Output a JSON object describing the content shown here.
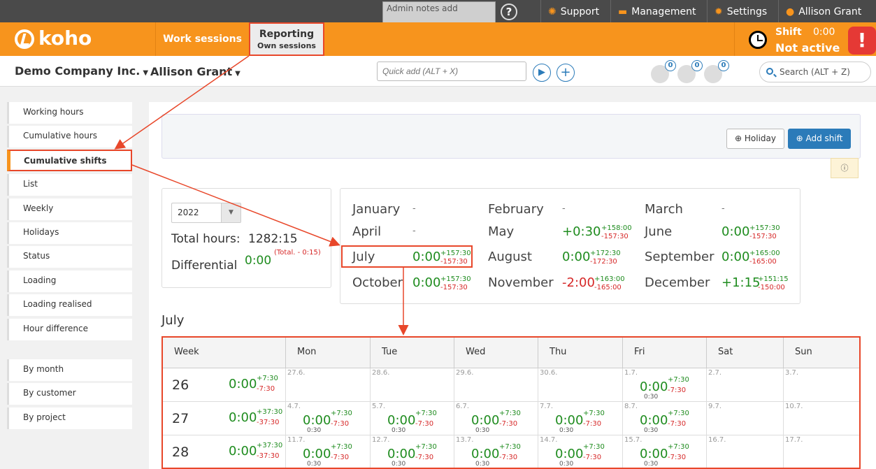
{
  "topbar": {
    "admin_notes_placeholder": "Admin notes add",
    "help": "?",
    "links": [
      {
        "label": "Support",
        "icon": "lifebuoy-icon"
      },
      {
        "label": "Management",
        "icon": "management-icon"
      },
      {
        "label": "Settings",
        "icon": "gear-icon"
      },
      {
        "label": "Allison Grant",
        "icon": "user-icon"
      }
    ]
  },
  "header": {
    "logo": "koho",
    "tabs": [
      {
        "label": "Work sessions",
        "sub": ""
      },
      {
        "label": "Reporting",
        "sub": "Own sessions"
      }
    ],
    "shift": {
      "label": "Shift",
      "time": "0:00",
      "status": "Not active"
    },
    "alert": "!"
  },
  "subheader": {
    "company": "Demo Company Inc.",
    "person": "Allison Grant",
    "quick_add_placeholder": "Quick add (ALT + X)",
    "notifications": [
      "0",
      "0",
      "0"
    ],
    "search_placeholder": "Search (ALT + Z)"
  },
  "sidebar": {
    "items": [
      "Working hours",
      "Cumulative hours",
      "Cumulative shifts",
      "List",
      "Weekly",
      "Holidays",
      "Status",
      "Loading",
      "Loading realised",
      "Hour difference"
    ],
    "group2": [
      "By month",
      "By customer",
      "By project"
    ]
  },
  "toolbar": {
    "holiday": "Holiday",
    "add_shift": "Add shift",
    "info": "i"
  },
  "year_panel": {
    "year": "2022",
    "total_label": "Total hours:",
    "total_value": "1282:15",
    "diff_label": "Differential",
    "diff_value": "0:00",
    "diff_note": "(Total. - 0:15)"
  },
  "months": [
    {
      "name": "January",
      "value": "-",
      "plus": "",
      "minus": ""
    },
    {
      "name": "February",
      "value": "-",
      "plus": "",
      "minus": ""
    },
    {
      "name": "March",
      "value": "-",
      "plus": "",
      "minus": ""
    },
    {
      "name": "April",
      "value": "-",
      "plus": "",
      "minus": ""
    },
    {
      "name": "May",
      "value": "+0:30",
      "plus": "+158:00",
      "minus": "-157:30"
    },
    {
      "name": "June",
      "value": "0:00",
      "plus": "+157:30",
      "minus": "-157:30"
    },
    {
      "name": "July",
      "value": "0:00",
      "plus": "+157:30",
      "minus": "-157:30"
    },
    {
      "name": "August",
      "value": "0:00",
      "plus": "+172:30",
      "minus": "-172:30"
    },
    {
      "name": "September",
      "value": "0:00",
      "plus": "+165:00",
      "minus": "-165:00"
    },
    {
      "name": "October",
      "value": "0:00",
      "plus": "+157:30",
      "minus": "-157:30"
    },
    {
      "name": "November",
      "value": "-2:00",
      "plus": "+163:00",
      "minus": "-165:00"
    },
    {
      "name": "December",
      "value": "+1:15",
      "plus": "+151:15",
      "minus": "-150:00"
    }
  ],
  "month_title": "July",
  "calendar": {
    "headers": [
      "Week",
      "Mon",
      "Tue",
      "Wed",
      "Thu",
      "Fri",
      "Sat",
      "Sun"
    ],
    "rows": [
      {
        "week": "26",
        "val": "0:00",
        "plus": "+7:30",
        "minus": "-7:30",
        "days": [
          {
            "date": "27.6."
          },
          {
            "date": "28.6."
          },
          {
            "date": "29.6."
          },
          {
            "date": "30.6."
          },
          {
            "date": "1.7.",
            "val": "0:00",
            "sub": "0:30",
            "plus": "+7:30",
            "minus": "-7:30"
          },
          {
            "date": "2.7."
          },
          {
            "date": "3.7."
          }
        ]
      },
      {
        "week": "27",
        "val": "0:00",
        "plus": "+37:30",
        "minus": "-37:30",
        "days": [
          {
            "date": "4.7.",
            "val": "0:00",
            "sub": "0:30",
            "plus": "+7:30",
            "minus": "-7:30"
          },
          {
            "date": "5.7.",
            "val": "0:00",
            "sub": "0:30",
            "plus": "+7:30",
            "minus": "-7:30"
          },
          {
            "date": "6.7.",
            "val": "0:00",
            "sub": "0:30",
            "plus": "+7:30",
            "minus": "-7:30"
          },
          {
            "date": "7.7.",
            "val": "0:00",
            "sub": "0:30",
            "plus": "+7:30",
            "minus": "-7:30"
          },
          {
            "date": "8.7.",
            "val": "0:00",
            "sub": "0:30",
            "plus": "+7:30",
            "minus": "-7:30"
          },
          {
            "date": "9.7."
          },
          {
            "date": "10.7."
          }
        ]
      },
      {
        "week": "28",
        "val": "0:00",
        "plus": "+37:30",
        "minus": "-37:30",
        "days": [
          {
            "date": "11.7.",
            "val": "0:00",
            "sub": "0:30",
            "plus": "+7:30",
            "minus": "-7:30"
          },
          {
            "date": "12.7.",
            "val": "0:00",
            "sub": "0:30",
            "plus": "+7:30",
            "minus": "-7:30"
          },
          {
            "date": "13.7.",
            "val": "0:00",
            "sub": "0:30",
            "plus": "+7:30",
            "minus": "-7:30"
          },
          {
            "date": "14.7.",
            "val": "0:00",
            "sub": "0:30",
            "plus": "+7:30",
            "minus": "-7:30"
          },
          {
            "date": "15.7.",
            "val": "0:00",
            "sub": "0:30",
            "plus": "+7:30",
            "minus": "-7:30"
          },
          {
            "date": "16.7."
          },
          {
            "date": "17.7."
          }
        ]
      }
    ]
  },
  "colors": {
    "brand": "#f7941d",
    "accent": "#2b7bb9",
    "positive": "#1f8c1f",
    "negative": "#d62828",
    "highlight": "#e8472a"
  }
}
